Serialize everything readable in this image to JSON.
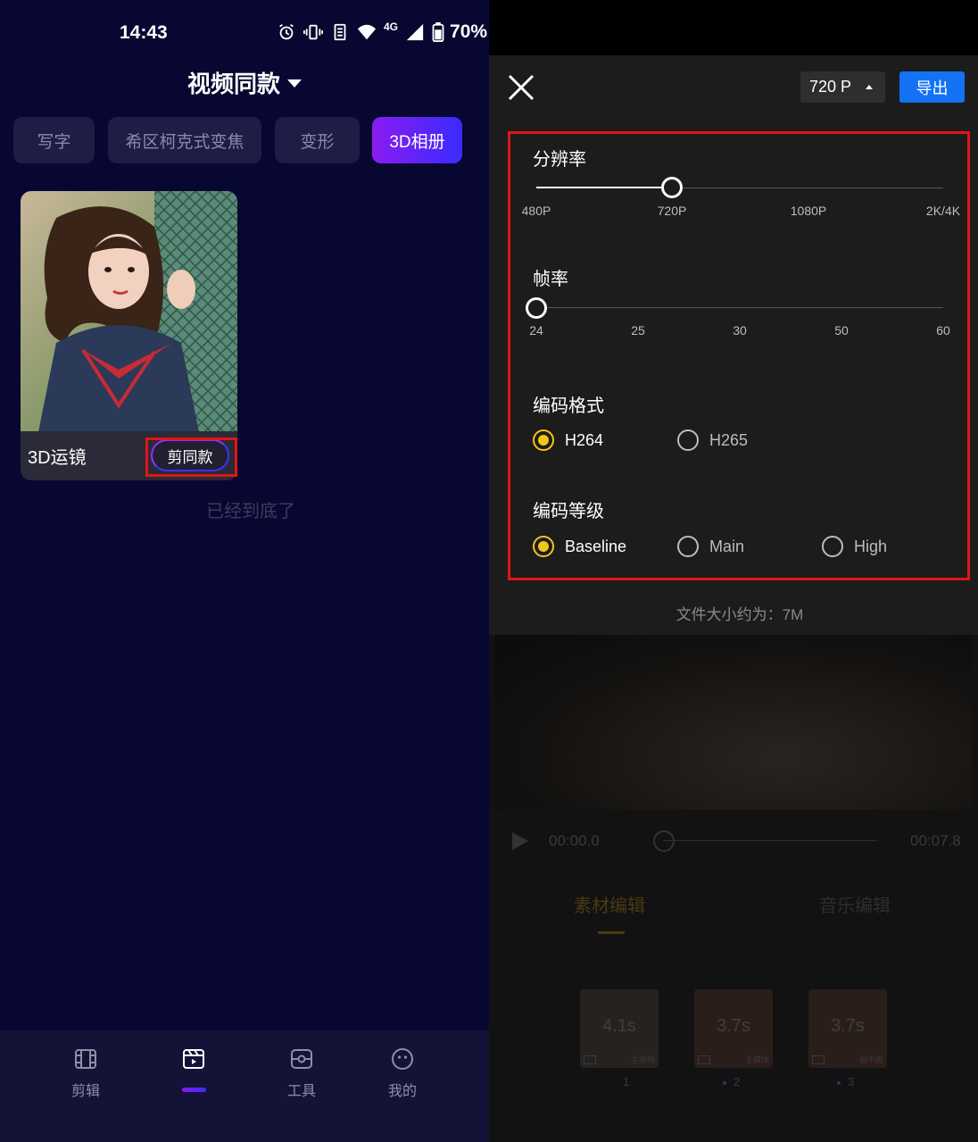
{
  "left": {
    "status": {
      "time": "14:43",
      "battery": "70%",
      "network": "4G"
    },
    "page_title": "视频同款",
    "chips": [
      {
        "label": "写字"
      },
      {
        "label": "希区柯克式变焦"
      },
      {
        "label": "变形"
      },
      {
        "label": "3D相册",
        "active": true
      }
    ],
    "card": {
      "title": "3D运镜",
      "button": "剪同款"
    },
    "end_note": "已经到底了",
    "nav": [
      {
        "label": "剪辑",
        "icon": "film-icon"
      },
      {
        "label": "",
        "icon": "template-icon",
        "active": true
      },
      {
        "label": "工具",
        "icon": "toolbox-icon"
      },
      {
        "label": "我的",
        "icon": "face-icon"
      }
    ]
  },
  "right": {
    "resolution_select": "720 P",
    "export_label": "导出",
    "resolution": {
      "label": "分辨率",
      "ticks": [
        "480P",
        "720P",
        "1080P",
        "2K/4K"
      ],
      "selected": "720P"
    },
    "framerate": {
      "label": "帧率",
      "ticks": [
        "24",
        "25",
        "30",
        "50",
        "60"
      ],
      "selected": "24"
    },
    "codec": {
      "label": "编码格式",
      "options": [
        "H264",
        "H265"
      ],
      "selected": "H264"
    },
    "profile": {
      "label": "编码等级",
      "options": [
        "Baseline",
        "Main",
        "High"
      ],
      "selected": "Baseline"
    },
    "file_size": "文件大小约为：7M",
    "player": {
      "current": "00:00.0",
      "total": "00:07.8"
    },
    "tabs": [
      "素材编辑",
      "音乐编辑"
    ],
    "clips": [
      {
        "duration": "4.1s",
        "caption": "主视频",
        "index": "1"
      },
      {
        "duration": "3.7s",
        "caption": "主媒体",
        "index": "2"
      },
      {
        "duration": "3.7s",
        "caption": "画中画",
        "index": "3"
      }
    ]
  }
}
